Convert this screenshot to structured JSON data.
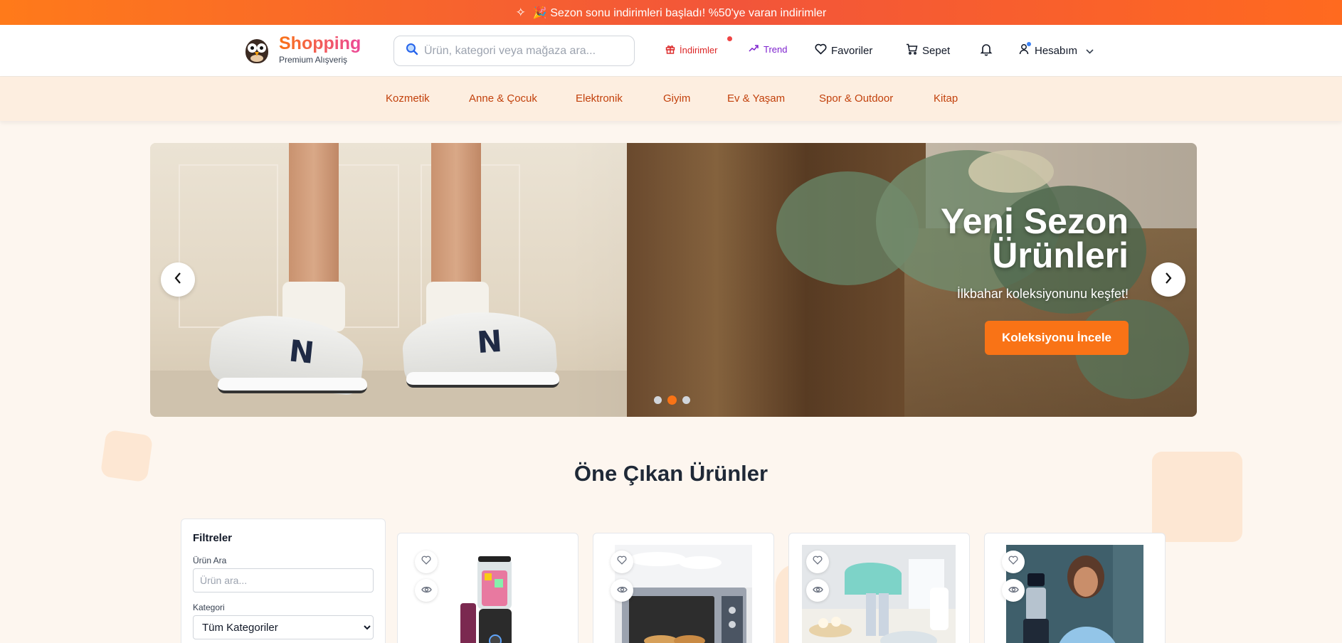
{
  "promo": {
    "text": "🎉 Sezon sonu indirimleri başladı! %50'ye varan indirimler"
  },
  "brand": {
    "name": "Shopping",
    "tagline": "Premium Alışveriş"
  },
  "search": {
    "placeholder": "Ürün, kategori veya mağaza ara..."
  },
  "header_actions": {
    "deals": "İndirimler",
    "trend": "Trend",
    "favorites": "Favoriler",
    "cart": "Sepet",
    "account": "Hesabım"
  },
  "categories": [
    "Kozmetik",
    "Anne & Çocuk",
    "Elektronik",
    "Giyim",
    "Ev & Yaşam",
    "Spor & Outdoor",
    "Kitap"
  ],
  "hero": {
    "title_line1": "Yeni Sezon",
    "title_line2": "Ürünleri",
    "subtitle": "İlkbahar koleksiyonunu keşfet!",
    "cta": "Koleksiyonu İncele",
    "slides_total": 3,
    "active_slide": 2
  },
  "section": {
    "title": "Öne Çıkan Ürünler"
  },
  "filters": {
    "title": "Filtreler",
    "search_label": "Ürün Ara",
    "search_placeholder": "Ürün ara...",
    "category_label": "Kategori",
    "category_selected": "Tüm Kategoriler"
  },
  "products": [
    {
      "image": "blender-image"
    },
    {
      "image": "toaster-oven-image"
    },
    {
      "image": "hand-mixer-image"
    },
    {
      "image": "food-processor-image"
    }
  ],
  "colors": {
    "accent": "#f97316",
    "promo_start": "#ff7a1a",
    "promo_end": "#f2553a",
    "category_text": "#c2410c",
    "deals": "#dc2626",
    "trend": "#7e22ce"
  }
}
